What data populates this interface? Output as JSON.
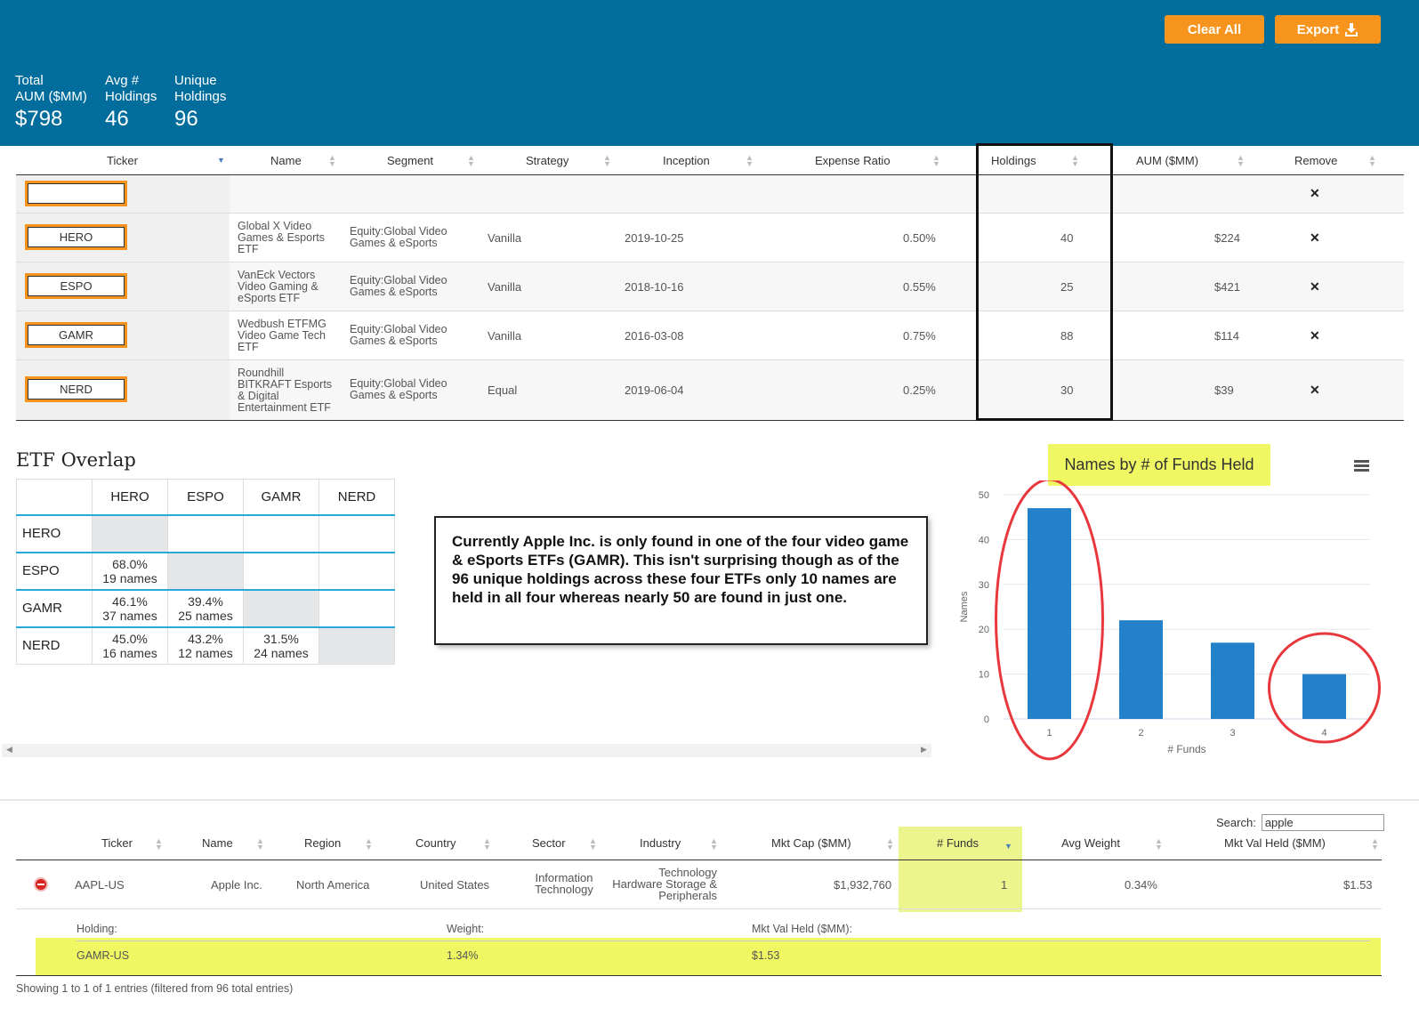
{
  "header": {
    "clear_all_label": "Clear All",
    "export_label": "Export",
    "stats": [
      {
        "label": "Total\nAUM ($MM)",
        "value": "$798"
      },
      {
        "label": "Avg #\nHoldings",
        "value": "46"
      },
      {
        "label": "Unique\nHoldings",
        "value": "96"
      }
    ]
  },
  "etf_table": {
    "columns": [
      "Ticker",
      "Name",
      "Segment",
      "Strategy",
      "Inception",
      "Expense Ratio",
      "Holdings",
      "AUM ($MM)",
      "Remove"
    ],
    "rows": [
      {
        "ticker": "HERO",
        "name": "Global X Video Games & Esports ETF",
        "segment": "Equity:Global Video Games & eSports",
        "strategy": "Vanilla",
        "inception": "2019-10-25",
        "expense": "0.50%",
        "holdings": "40",
        "aum": "$224"
      },
      {
        "ticker": "ESPO",
        "name": "VanEck Vectors Video Gaming & eSports ETF",
        "segment": "Equity:Global Video Games & eSports",
        "strategy": "Vanilla",
        "inception": "2018-10-16",
        "expense": "0.55%",
        "holdings": "25",
        "aum": "$421"
      },
      {
        "ticker": "GAMR",
        "name": "Wedbush ETFMG Video Game Tech ETF",
        "segment": "Equity:Global Video Games & eSports",
        "strategy": "Vanilla",
        "inception": "2016-03-08",
        "expense": "0.75%",
        "holdings": "88",
        "aum": "$114"
      },
      {
        "ticker": "NERD",
        "name": "Roundhill BITKRAFT Esports & Digital Entertainment ETF",
        "segment": "Equity:Global Video Games & eSports",
        "strategy": "Equal",
        "inception": "2019-06-04",
        "expense": "0.25%",
        "holdings": "30",
        "aum": "$39"
      }
    ],
    "remove_icon": "close-icon"
  },
  "overlap": {
    "title": "ETF Overlap",
    "tickers": [
      "HERO",
      "ESPO",
      "GAMR",
      "NERD"
    ],
    "cells": {
      "ESPO_HERO": {
        "pct": "68.0%",
        "names": "19 names"
      },
      "GAMR_HERO": {
        "pct": "46.1%",
        "names": "37 names"
      },
      "GAMR_ESPO": {
        "pct": "39.4%",
        "names": "25 names"
      },
      "NERD_HERO": {
        "pct": "45.0%",
        "names": "16 names"
      },
      "NERD_ESPO": {
        "pct": "43.2%",
        "names": "12 names"
      },
      "NERD_GAMR": {
        "pct": "31.5%",
        "names": "24 names"
      }
    }
  },
  "callout": "Currently Apple Inc. is only found in one of the four video game & eSports ETFs (GAMR). This isn't surprising though as of the 96 unique holdings across these four ETFs only 10 names are held in all four whereas nearly 50 are found in just one.",
  "chart_data": {
    "type": "bar",
    "title": "Names by # of Funds Held",
    "xlabel": "# Funds",
    "ylabel": "Names",
    "categories": [
      "1",
      "2",
      "3",
      "4"
    ],
    "values": [
      47,
      22,
      17,
      10
    ],
    "ylim": [
      0,
      50
    ],
    "yticks": [
      0,
      10,
      20,
      30,
      40,
      50
    ],
    "color": "#2281c9",
    "grid": true
  },
  "holdings_table": {
    "search_label": "Search:",
    "search_value": "apple",
    "columns": [
      "Ticker",
      "Name",
      "Region",
      "Country",
      "Sector",
      "Industry",
      "Mkt Cap ($MM)",
      "# Funds",
      "Avg Weight",
      "Mkt Val Held ($MM)"
    ],
    "row": {
      "ticker": "AAPL-US",
      "name": "Apple Inc.",
      "region": "North America",
      "country": "United States",
      "sector": "Information Technology",
      "industry": "Technology Hardware Storage & Peripherals",
      "mktcap": "$1,932,760",
      "funds": "1",
      "avg_weight": "0.34%",
      "mktval": "$1.53"
    },
    "detail": {
      "holding_label": "Holding:",
      "weight_label": "Weight:",
      "mktval_label": "Mkt Val Held ($MM):",
      "holding": "GAMR-US",
      "weight": "1.34%",
      "mktval": "$1.53"
    },
    "info": "Showing 1 to 1 of 1 entries (filtered from 96 total entries)"
  },
  "colors": {
    "header_bg": "#006d9c",
    "accent_orange": "#f7941d",
    "highlight_yellow": "#eff762",
    "annotation_red": "#e8383d"
  }
}
